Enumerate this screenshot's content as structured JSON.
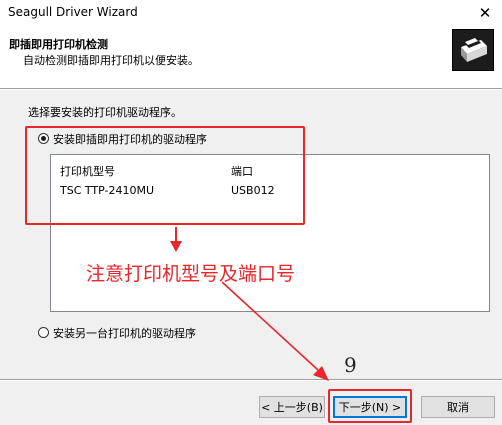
{
  "window": {
    "title": "Seagull Driver Wizard",
    "close_glyph": "✕"
  },
  "header": {
    "title": "即插即用打印机检测",
    "subtitle": "自动检测即插即用打印机以便安装。",
    "icon": "printer-icon"
  },
  "prompt": "选择要安装的打印机驱动程序。",
  "options": {
    "plug_and_play": {
      "label": "安装即插即用打印机的驱动程序",
      "selected": true
    },
    "another": {
      "label": "安装另一台打印机的驱动程序",
      "selected": false
    }
  },
  "printer_list": {
    "columns": [
      "打印机型号",
      "端口"
    ],
    "rows": [
      [
        "TSC TTP-2410MU",
        "USB012"
      ]
    ]
  },
  "annotations": {
    "note": "注意打印机型号及端口号",
    "step_number": "9",
    "highlight_color": "#e8262c"
  },
  "buttons": {
    "back": "< 上一步(B)",
    "next": "下一步(N) >",
    "cancel": "取消"
  }
}
